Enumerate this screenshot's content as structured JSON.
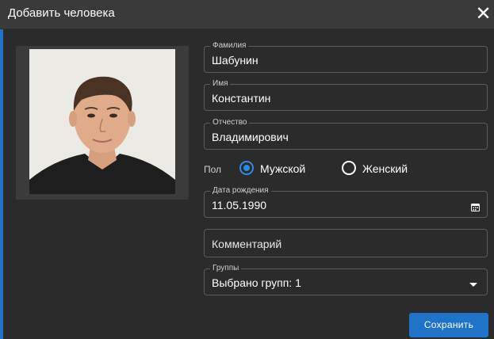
{
  "dialog": {
    "title": "Добавить человека",
    "close_glyph": "✕"
  },
  "form": {
    "last_name": {
      "label": "Фамилия",
      "value": "Шабунин"
    },
    "first_name": {
      "label": "Имя",
      "value": "Константин"
    },
    "middle_name": {
      "label": "Отчество",
      "value": "Владимирович"
    },
    "gender": {
      "label": "Пол",
      "options": [
        {
          "label": "Мужской",
          "checked": true
        },
        {
          "label": "Женский",
          "checked": false
        }
      ]
    },
    "birth_date": {
      "label": "Дата рождения",
      "value": "11.05.1990",
      "icon": "calendar-icon"
    },
    "comment": {
      "placeholder": "Комментарий"
    },
    "groups": {
      "label": "Группы",
      "value": "Выбрано групп: 1",
      "icon": "chevron-down-icon"
    }
  },
  "actions": {
    "save_label": "Сохранить"
  },
  "colors": {
    "accent": "#1f73c8",
    "radio_selected": "#2f8be6",
    "background": "#2b2b2b",
    "titlebar": "#3a3a3a"
  }
}
